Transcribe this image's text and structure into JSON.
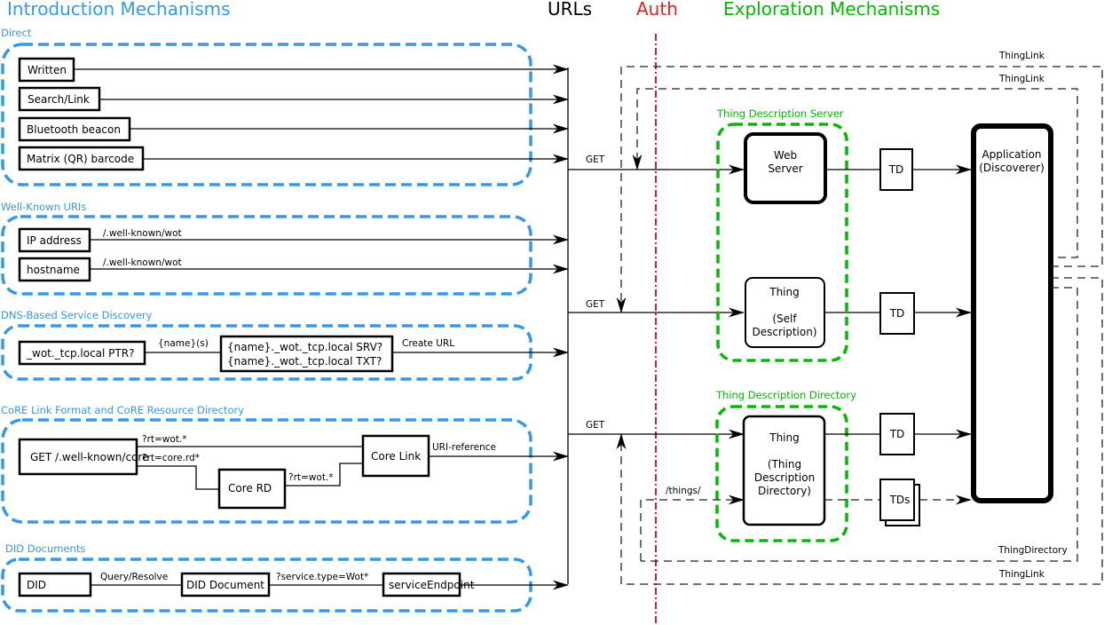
{
  "headers": {
    "introduction": "Introduction Mechanisms",
    "urls": "URLs",
    "auth": "Auth",
    "exploration": "Exploration Mechanisms"
  },
  "colors": {
    "introduction": "#3399ee",
    "exploration": "#00bb00",
    "auth": "#dd2222",
    "lines": "#000000"
  },
  "groups": {
    "direct": {
      "label": "Direct",
      "items": [
        "Written",
        "Search/Link",
        "Bluetooth beacon",
        "Matrix (QR) barcode"
      ]
    },
    "well_known": {
      "label": "Well-Known URIs",
      "items": [
        "IP address",
        "hostname"
      ],
      "edge_label": "/.well-known/wot"
    },
    "dns_sd": {
      "label": "DNS-Based Service Discovery",
      "ptr": "_wot._tcp.local PTR?",
      "names_label": "{name}(s)",
      "srv": "{name}._wot._tcp.local SRV?",
      "txt": "{name}._wot._tcp.local TXT?",
      "create_url": "Create URL"
    },
    "core": {
      "label": "CoRE Link Format and CoRE Resource Directory",
      "get": "GET /.well-known/core",
      "rt_wot": "?rt=wot.*",
      "rt_core_rd": "?rt=core.rd*",
      "core_rd": "Core RD",
      "rt_wot2": "?rt=wot.*",
      "core_link": "Core Link",
      "uri_ref": "URI-reference"
    },
    "did": {
      "label": "DID Documents",
      "did": "DID",
      "query": "Query/Resolve",
      "doc": "DID Document",
      "service_type": "?service.type=Wot*",
      "endpoint": "serviceEndpoint"
    }
  },
  "exploration": {
    "get_label": "GET",
    "td_server": {
      "label": "Thing Description Server",
      "web_server": [
        "Web",
        "Server"
      ]
    },
    "self_description": [
      "Thing",
      "",
      "(Self",
      "Description)"
    ],
    "td_directory": {
      "label": "Thing Description Directory",
      "thing": [
        "Thing",
        "",
        "(Thing",
        "Description",
        "Directory)"
      ],
      "things_path": "/things/"
    },
    "td": "TD",
    "tds": "TDs",
    "application": [
      "Application",
      "(Discoverer)"
    ],
    "loops": {
      "thinglink_outer_top": "ThingLink",
      "thinglink_inner_top": "ThingLink",
      "thing_directory": "ThingDirectory",
      "thinglink_bottom": "ThingLink"
    }
  }
}
